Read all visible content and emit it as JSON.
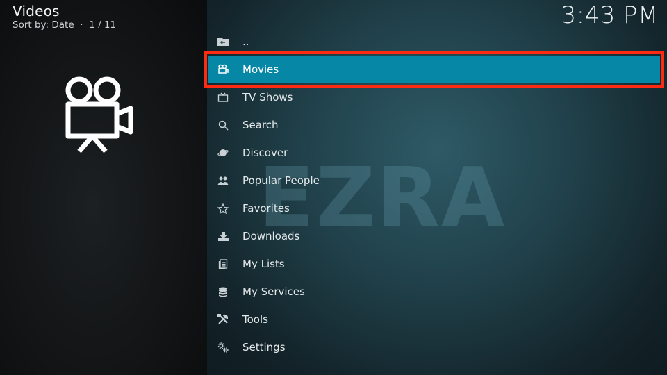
{
  "header": {
    "title": "Videos",
    "subtitle": "Sort by: Date  ·  1 / 11",
    "clock": "3:43 PM"
  },
  "hero": {
    "icon": "movie-camera-icon"
  },
  "watermark": "EZRA",
  "menu": {
    "selected_index": 1,
    "items": [
      {
        "label": "..",
        "icon": "folder-back-icon"
      },
      {
        "label": "Movies",
        "icon": "movie-camera-icon"
      },
      {
        "label": "TV Shows",
        "icon": "tv-icon"
      },
      {
        "label": "Search",
        "icon": "search-icon"
      },
      {
        "label": "Discover",
        "icon": "planet-icon"
      },
      {
        "label": "Popular People",
        "icon": "people-icon"
      },
      {
        "label": "Favorites",
        "icon": "star-icon"
      },
      {
        "label": "Downloads",
        "icon": "download-icon"
      },
      {
        "label": "My Lists",
        "icon": "list-icon"
      },
      {
        "label": "My Services",
        "icon": "database-icon"
      },
      {
        "label": "Tools",
        "icon": "tools-icon"
      },
      {
        "label": "Settings",
        "icon": "gear-icon"
      }
    ]
  },
  "colors": {
    "selected_bg": "#0787a6",
    "highlight_border": "#ff2a12",
    "right_panel": "#21424c",
    "left_panel": "#121415"
  }
}
